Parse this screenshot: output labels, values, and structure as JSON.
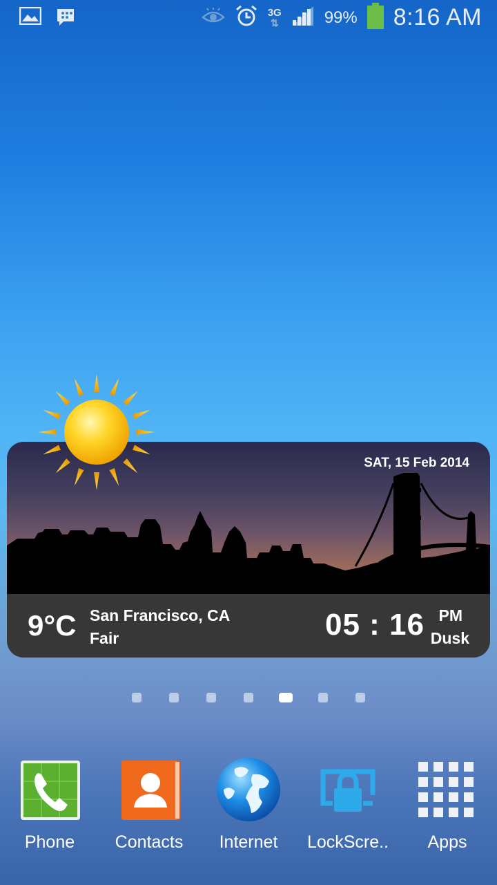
{
  "status_bar": {
    "left_icons": [
      "gallery-icon",
      "bbm-icon"
    ],
    "right_icons": [
      "eye-icon",
      "alarm-icon",
      "network-3g-icon",
      "signal-icon",
      "battery-icon"
    ],
    "network_type": "3G",
    "battery_percent": "99%",
    "time": "8:16 AM"
  },
  "widget": {
    "date": "SAT, 15 Feb 2014",
    "temperature": "9°C",
    "location": "San Francisco, CA",
    "condition": "Fair",
    "time": "05 : 16",
    "ampm": "PM",
    "period": "Dusk",
    "weather_icon": "sun-icon"
  },
  "page_indicator": {
    "count": 7,
    "active_index": 4
  },
  "dock": {
    "items": [
      {
        "label": "Phone",
        "icon": "phone-icon"
      },
      {
        "label": "Contacts",
        "icon": "contacts-icon"
      },
      {
        "label": "Internet",
        "icon": "globe-icon"
      },
      {
        "label": "LockScre..",
        "icon": "lock-icon"
      },
      {
        "label": "Apps",
        "icon": "apps-grid-icon"
      }
    ]
  },
  "colors": {
    "phone": "#5bb030",
    "contacts": "#f06a1e",
    "lock": "#2ea9ea",
    "battery": "#6cc04a"
  }
}
